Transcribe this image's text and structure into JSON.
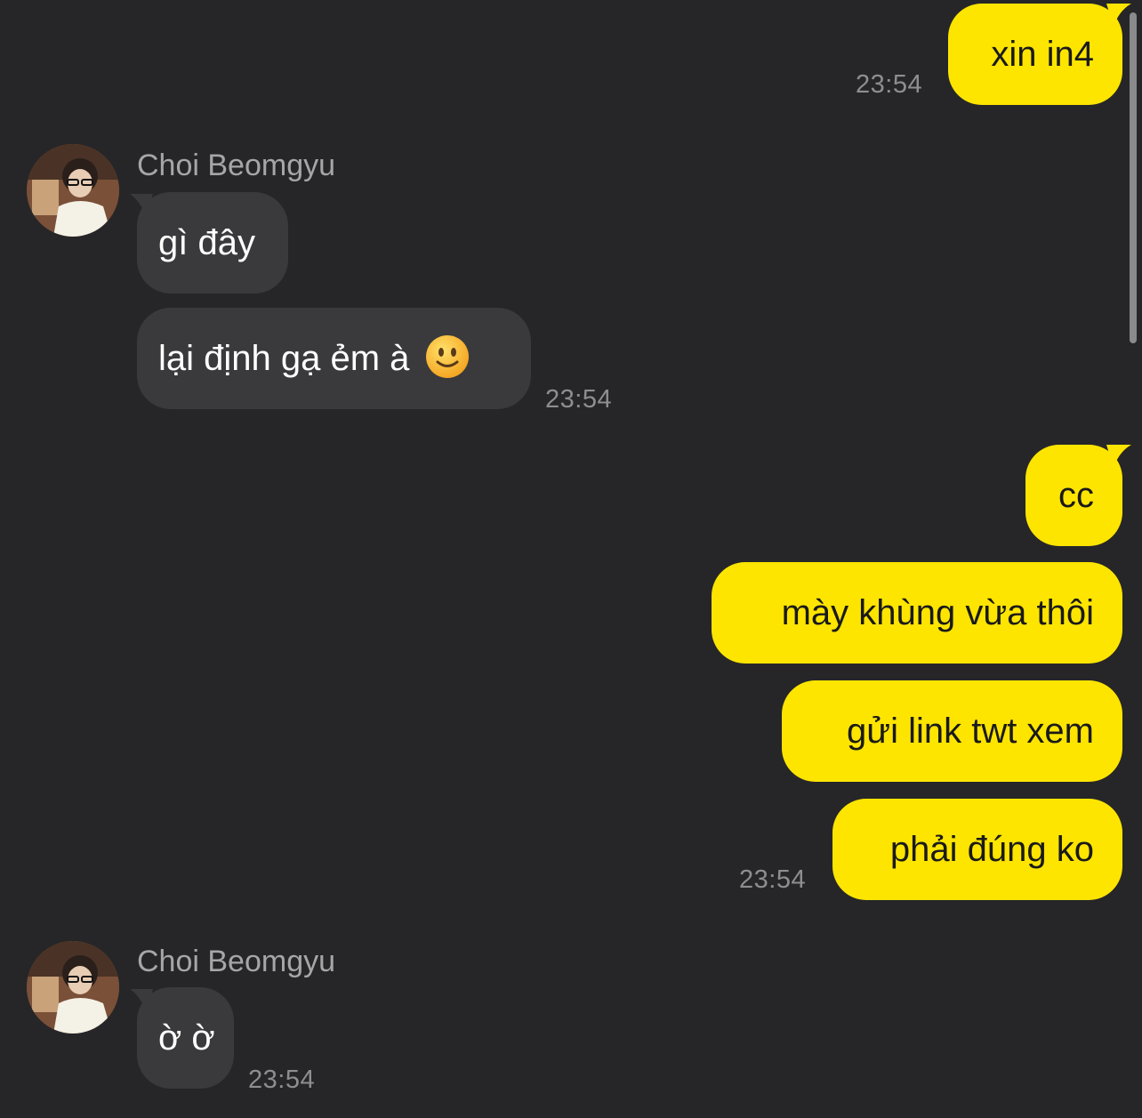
{
  "conversation": {
    "contact_name": "Choi Beomgyu",
    "messages": [
      {
        "id": "m1",
        "direction": "outgoing",
        "text": "xin in4",
        "time": "23:54"
      },
      {
        "id": "m2",
        "direction": "incoming",
        "text": "gì đây"
      },
      {
        "id": "m3",
        "direction": "incoming",
        "text": "lại định gạ ẻm à",
        "emoji": "slightly-smiling-face",
        "time": "23:54"
      },
      {
        "id": "m4",
        "direction": "outgoing",
        "text": "cc"
      },
      {
        "id": "m5",
        "direction": "outgoing",
        "text": "mày khùng vừa thôi"
      },
      {
        "id": "m6",
        "direction": "outgoing",
        "text": "gửi link twt xem"
      },
      {
        "id": "m7",
        "direction": "outgoing",
        "text": "phải đúng ko",
        "time": "23:54"
      },
      {
        "id": "m8",
        "direction": "incoming",
        "text": "ờ ờ",
        "time": "23:54"
      }
    ]
  },
  "colors": {
    "background": "#262628",
    "outgoing_bubble": "#FEE500",
    "incoming_bubble": "#3a3a3c",
    "timestamp": "#8e8e90",
    "sender_name": "#a6a6a8"
  },
  "icons": {
    "avatar": "profile-photo",
    "emoji": "slightly-smiling-face-icon"
  }
}
